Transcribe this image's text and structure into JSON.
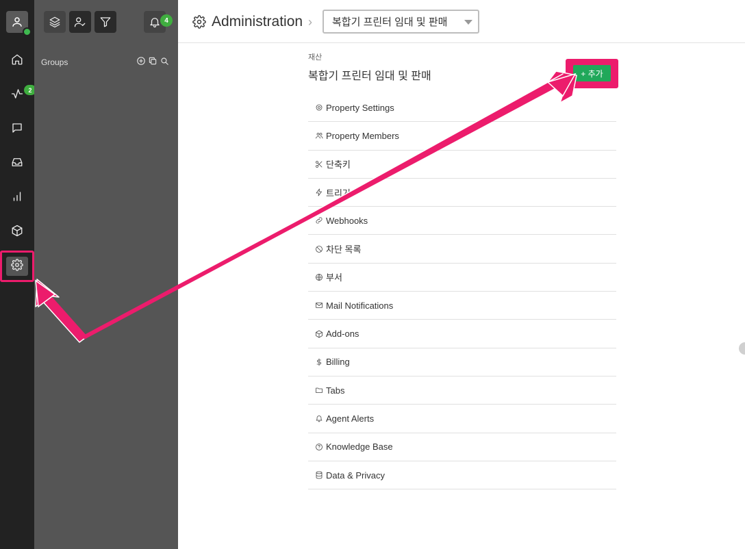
{
  "rail": {
    "activity_badge": "2",
    "items": [
      {
        "name": "home-icon"
      },
      {
        "name": "activity-icon"
      },
      {
        "name": "chat-icon"
      },
      {
        "name": "inbox-icon"
      },
      {
        "name": "reports-icon"
      },
      {
        "name": "package-icon"
      },
      {
        "name": "settings-icon"
      }
    ]
  },
  "groups_panel": {
    "label": "Groups",
    "notification_count": "4"
  },
  "header": {
    "title": "Administration",
    "property_selected": "복합기 프린터 임대 및 판매"
  },
  "main": {
    "breadcrumb": "재산",
    "property_name": "복합기 프린터 임대 및 판매",
    "add_button": "+ 추가",
    "menu": [
      {
        "label": "Property Settings",
        "icon": "gear-icon"
      },
      {
        "label": "Property Members",
        "icon": "users-icon"
      },
      {
        "label": "단축키",
        "icon": "scissors-icon"
      },
      {
        "label": "트리거",
        "icon": "bolt-icon"
      },
      {
        "label": "Webhooks",
        "icon": "link-icon"
      },
      {
        "label": "차단 목록",
        "icon": "block-icon"
      },
      {
        "label": "부서",
        "icon": "globe-icon"
      },
      {
        "label": "Mail Notifications",
        "icon": "mail-icon"
      },
      {
        "label": "Add-ons",
        "icon": "box-icon"
      },
      {
        "label": "Billing",
        "icon": "dollar-icon"
      },
      {
        "label": "Tabs",
        "icon": "folder-icon"
      },
      {
        "label": "Agent Alerts",
        "icon": "bell-icon"
      },
      {
        "label": "Knowledge Base",
        "icon": "help-circle-icon"
      },
      {
        "label": "Data & Privacy",
        "icon": "database-icon"
      }
    ]
  },
  "colors": {
    "highlight": "#ec1c6c",
    "add_button": "#20a85a",
    "badge": "#3fae3f"
  }
}
